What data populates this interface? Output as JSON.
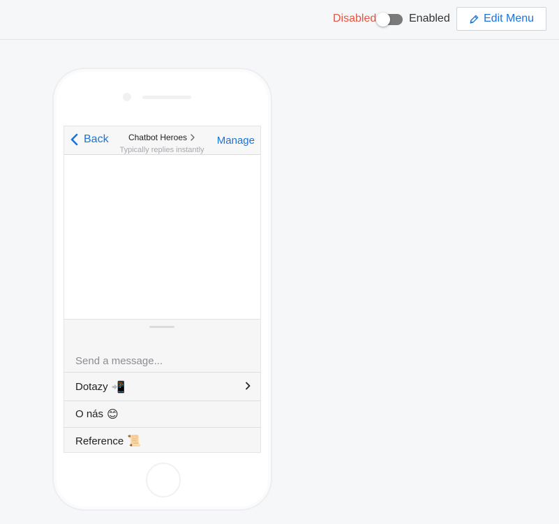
{
  "topbar": {
    "disabled_label": "Disabled",
    "enabled_label": "Enabled",
    "toggle_on": false,
    "edit_menu_label": "Edit Menu",
    "colors": {
      "disabled": "#e8523f",
      "accent": "#1a73d9"
    }
  },
  "chat": {
    "back_label": "Back",
    "title": "Chatbot Heroes",
    "subtitle": "Typically replies instantly",
    "manage_label": "Manage",
    "input_placeholder": "Send a message...",
    "menu": [
      {
        "label": "Dotazy",
        "emoji": "📲",
        "has_submenu": true
      },
      {
        "label": "O nás",
        "emoji": "😊",
        "has_submenu": false
      },
      {
        "label": "Reference",
        "emoji": "📜",
        "has_submenu": false
      }
    ]
  },
  "icons": {
    "edit": "pen-icon",
    "back": "chevron-left-icon",
    "title_chevron": "chevron-right-icon",
    "submenu": "chevron-right-icon"
  }
}
